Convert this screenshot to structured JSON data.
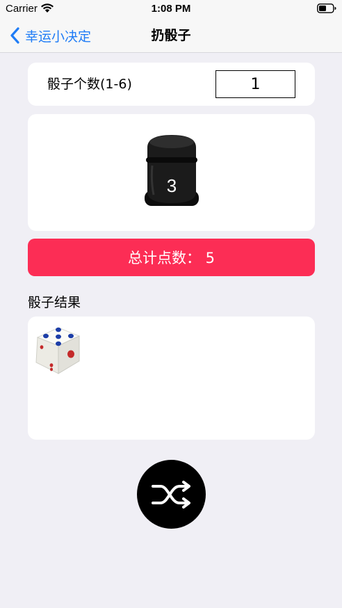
{
  "status_bar": {
    "carrier": "Carrier",
    "time": "1:08 PM",
    "wifi_icon": "wifi-icon",
    "battery_icon": "battery-icon"
  },
  "nav": {
    "back_label": "幸运小决定",
    "back_icon": "chevron-left-icon",
    "title": "扔骰子"
  },
  "dice_count": {
    "label": "骰子个数(1-6)",
    "value": "1"
  },
  "cup": {
    "number": "3",
    "icon": "dice-cup-icon"
  },
  "total": {
    "text": "总计点数：  5"
  },
  "results": {
    "heading": "骰子结果",
    "dice": [
      5
    ]
  },
  "shuffle": {
    "icon": "shuffle-icon"
  },
  "colors": {
    "accent_blue": "#1f7cf6",
    "total_bar_red": "#fc2d55",
    "background": "#f0eff5"
  }
}
